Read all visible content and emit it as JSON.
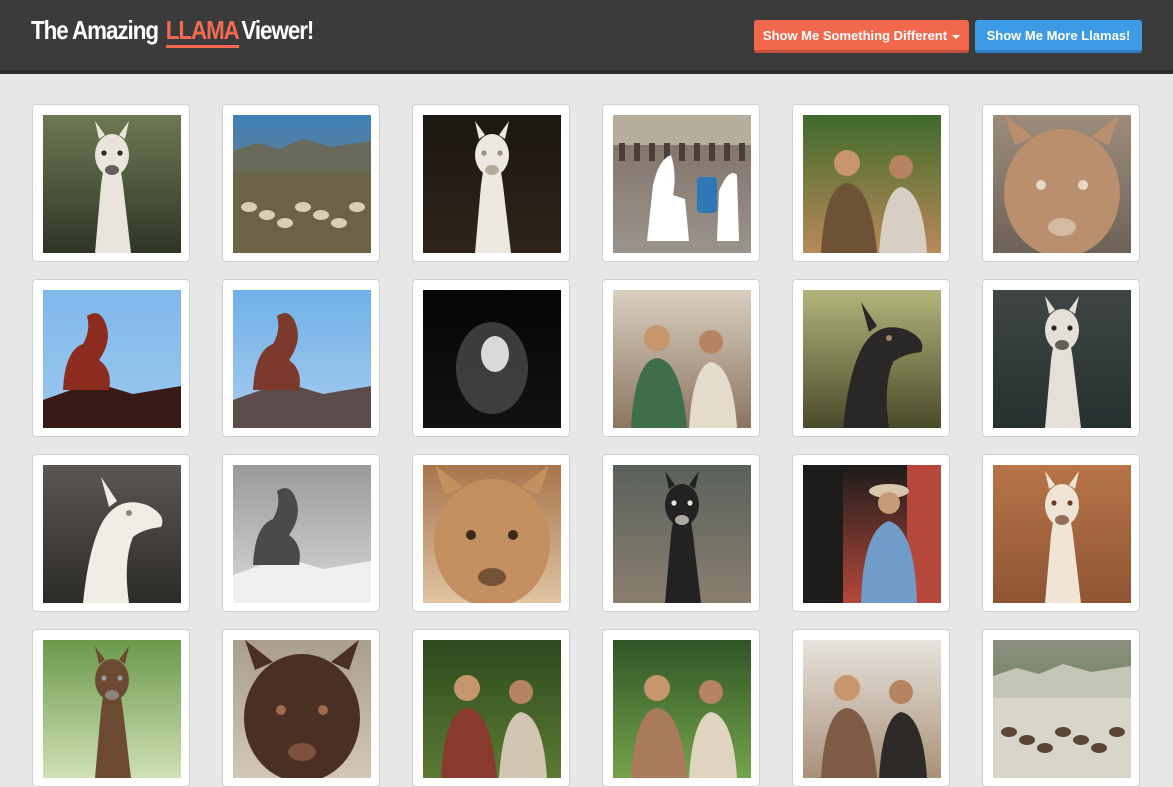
{
  "header": {
    "brand_prefix": "The Amazing",
    "brand_accent": "LLAMA",
    "brand_suffix": "Viewer!",
    "different_button_label": "Show Me Something Different",
    "more_button_label": "Show Me More Llamas!"
  },
  "colors": {
    "navbar": "#3b3b3b",
    "accent_orange": "#f2684d",
    "accent_blue": "#3d9be6",
    "page_background": "#e7e7e7"
  },
  "photos": [
    {
      "name": "llama-behind-fence-photo",
      "bg": [
        "#6c7a52",
        "#2f3527"
      ],
      "subject": "#e9e4dc",
      "accent": "#2b2a28",
      "kind": "llama"
    },
    {
      "name": "llama-herd-highlands-photo",
      "bg": [
        "#3f7fb6",
        "#8e8666"
      ],
      "subject": "#d8cfb7",
      "accent": "#6d6448",
      "kind": "landscape"
    },
    {
      "name": "llama-dark-background-photo",
      "bg": [
        "#1c1712",
        "#2f2418"
      ],
      "subject": "#ede8e0",
      "accent": "#9c8e77",
      "kind": "llama"
    },
    {
      "name": "plaza-llamas-with-people-photo",
      "bg": [
        "#7d6e62",
        "#9a948c"
      ],
      "subject": "#ffffff",
      "accent": "#2e78b8",
      "kind": "crowd"
    },
    {
      "name": "musicians-with-guitars-photo",
      "bg": [
        "#3f6b2b",
        "#b98a5a"
      ],
      "subject": "#6e5236",
      "accent": "#d7cfc3",
      "kind": "people"
    },
    {
      "name": "fluffy-brown-llama-closeup-photo",
      "bg": [
        "#9d8c7b",
        "#6d6258"
      ],
      "subject": "#b98f6d",
      "accent": "#e7d7c6",
      "kind": "closeup"
    },
    {
      "name": "llama-statue-against-sky-photo",
      "bg": [
        "#7fb8ea",
        "#9cc8f0"
      ],
      "subject": "#8b2c1f",
      "accent": "#3a1a14",
      "kind": "statue"
    },
    {
      "name": "llama-statue-on-rooftop-photo",
      "bg": [
        "#6fb0e8",
        "#a8cdee"
      ],
      "subject": "#7c3a2c",
      "accent": "#5b4b4b",
      "kind": "statue"
    },
    {
      "name": "llama-in-shadow-photo",
      "bg": [
        "#050505",
        "#121212"
      ],
      "subject": "#d9d9d9",
      "accent": "#777777",
      "kind": "dark"
    },
    {
      "name": "person-with-llama-photo",
      "bg": [
        "#d9cfc1",
        "#8c7660"
      ],
      "subject": "#3f6f4a",
      "accent": "#e6dccd",
      "kind": "people"
    },
    {
      "name": "dark-llama-profile-photo",
      "bg": [
        "#b2b57b",
        "#4a4b2a"
      ],
      "subject": "#2a2826",
      "accent": "#a1865f",
      "kind": "profile"
    },
    {
      "name": "white-llama-portrait-photo",
      "bg": [
        "#3f4645",
        "#26302f"
      ],
      "subject": "#e4e0d8",
      "accent": "#2c2622",
      "kind": "llama"
    },
    {
      "name": "white-llama-side-view-photo",
      "bg": [
        "#5a5752",
        "#2d2b28"
      ],
      "subject": "#f1ede6",
      "accent": "#8c857a",
      "kind": "profile"
    },
    {
      "name": "carved-llama-sculpture-photo",
      "bg": [
        "#9a9a9a",
        "#d8d8d8"
      ],
      "subject": "#4a4a4a",
      "accent": "#f0f0f0",
      "kind": "statue"
    },
    {
      "name": "shaggy-llama-face-photo",
      "bg": [
        "#a8754b",
        "#e0c4a2"
      ],
      "subject": "#c48f5e",
      "accent": "#3e2a1c",
      "kind": "closeup"
    },
    {
      "name": "black-white-llama-collage-photo",
      "bg": [
        "#59615b",
        "#8a7e6e"
      ],
      "subject": "#222222",
      "accent": "#e9e3da",
      "kind": "llama"
    },
    {
      "name": "man-in-cowboy-hat-photo",
      "bg": [
        "#1d1c1b",
        "#b5483a"
      ],
      "subject": "#6f9cc9",
      "accent": "#d9c7ad",
      "kind": "person"
    },
    {
      "name": "brown-llama-portrait-photo",
      "bg": [
        "#b77448",
        "#8e5534"
      ],
      "subject": "#f0e4d6",
      "accent": "#6b3d22",
      "kind": "llama"
    },
    {
      "name": "llama-behind-wire-fence-photo",
      "bg": [
        "#6b9a4a",
        "#cfe0b5"
      ],
      "subject": "#6d4a33",
      "accent": "#9b9b9b",
      "kind": "llama"
    },
    {
      "name": "llama-ears-closeup-photo",
      "bg": [
        "#a99d8c",
        "#d2c6b4"
      ],
      "subject": "#4a2f23",
      "accent": "#a06a4c",
      "kind": "closeup"
    },
    {
      "name": "person-in-forest-photo",
      "bg": [
        "#2c4a1d",
        "#5b7a33"
      ],
      "subject": "#8a3a2c",
      "accent": "#d1c6b1",
      "kind": "people"
    },
    {
      "name": "guitarist-in-garden-photo",
      "bg": [
        "#2f5526",
        "#75a34b"
      ],
      "subject": "#a97b5a",
      "accent": "#e1d5c0",
      "kind": "people"
    },
    {
      "name": "band-members-photo",
      "bg": [
        "#e7e4de",
        "#a99077"
      ],
      "subject": "#7d5b45",
      "accent": "#2d2a27",
      "kind": "people"
    },
    {
      "name": "mountain-valley-llama-photo",
      "bg": [
        "#8b8f7f",
        "#4f7a34"
      ],
      "subject": "#5b4534",
      "accent": "#d8d5c9",
      "kind": "landscape"
    }
  ]
}
